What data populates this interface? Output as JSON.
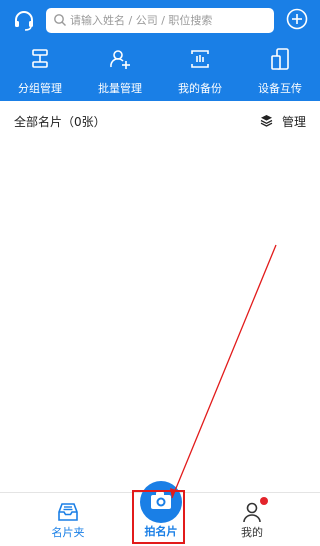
{
  "search": {
    "placeholder": "请输入姓名 / 公司 / 职位搜索"
  },
  "actions": [
    {
      "label": "分组管理",
      "icon": "group-manage-icon"
    },
    {
      "label": "批量管理",
      "icon": "batch-manage-icon"
    },
    {
      "label": "我的备份",
      "icon": "backup-icon"
    },
    {
      "label": "设备互传",
      "icon": "device-transfer-icon"
    }
  ],
  "section": {
    "title": "全部名片（0张）",
    "manage_label": "管理"
  },
  "nav": {
    "cards_label": "名片夹",
    "capture_label": "拍名片",
    "mine_label": "我的"
  },
  "colors": {
    "primary": "#1a7fe6",
    "highlight": "#e21b1b",
    "badge": "#e3242b"
  }
}
